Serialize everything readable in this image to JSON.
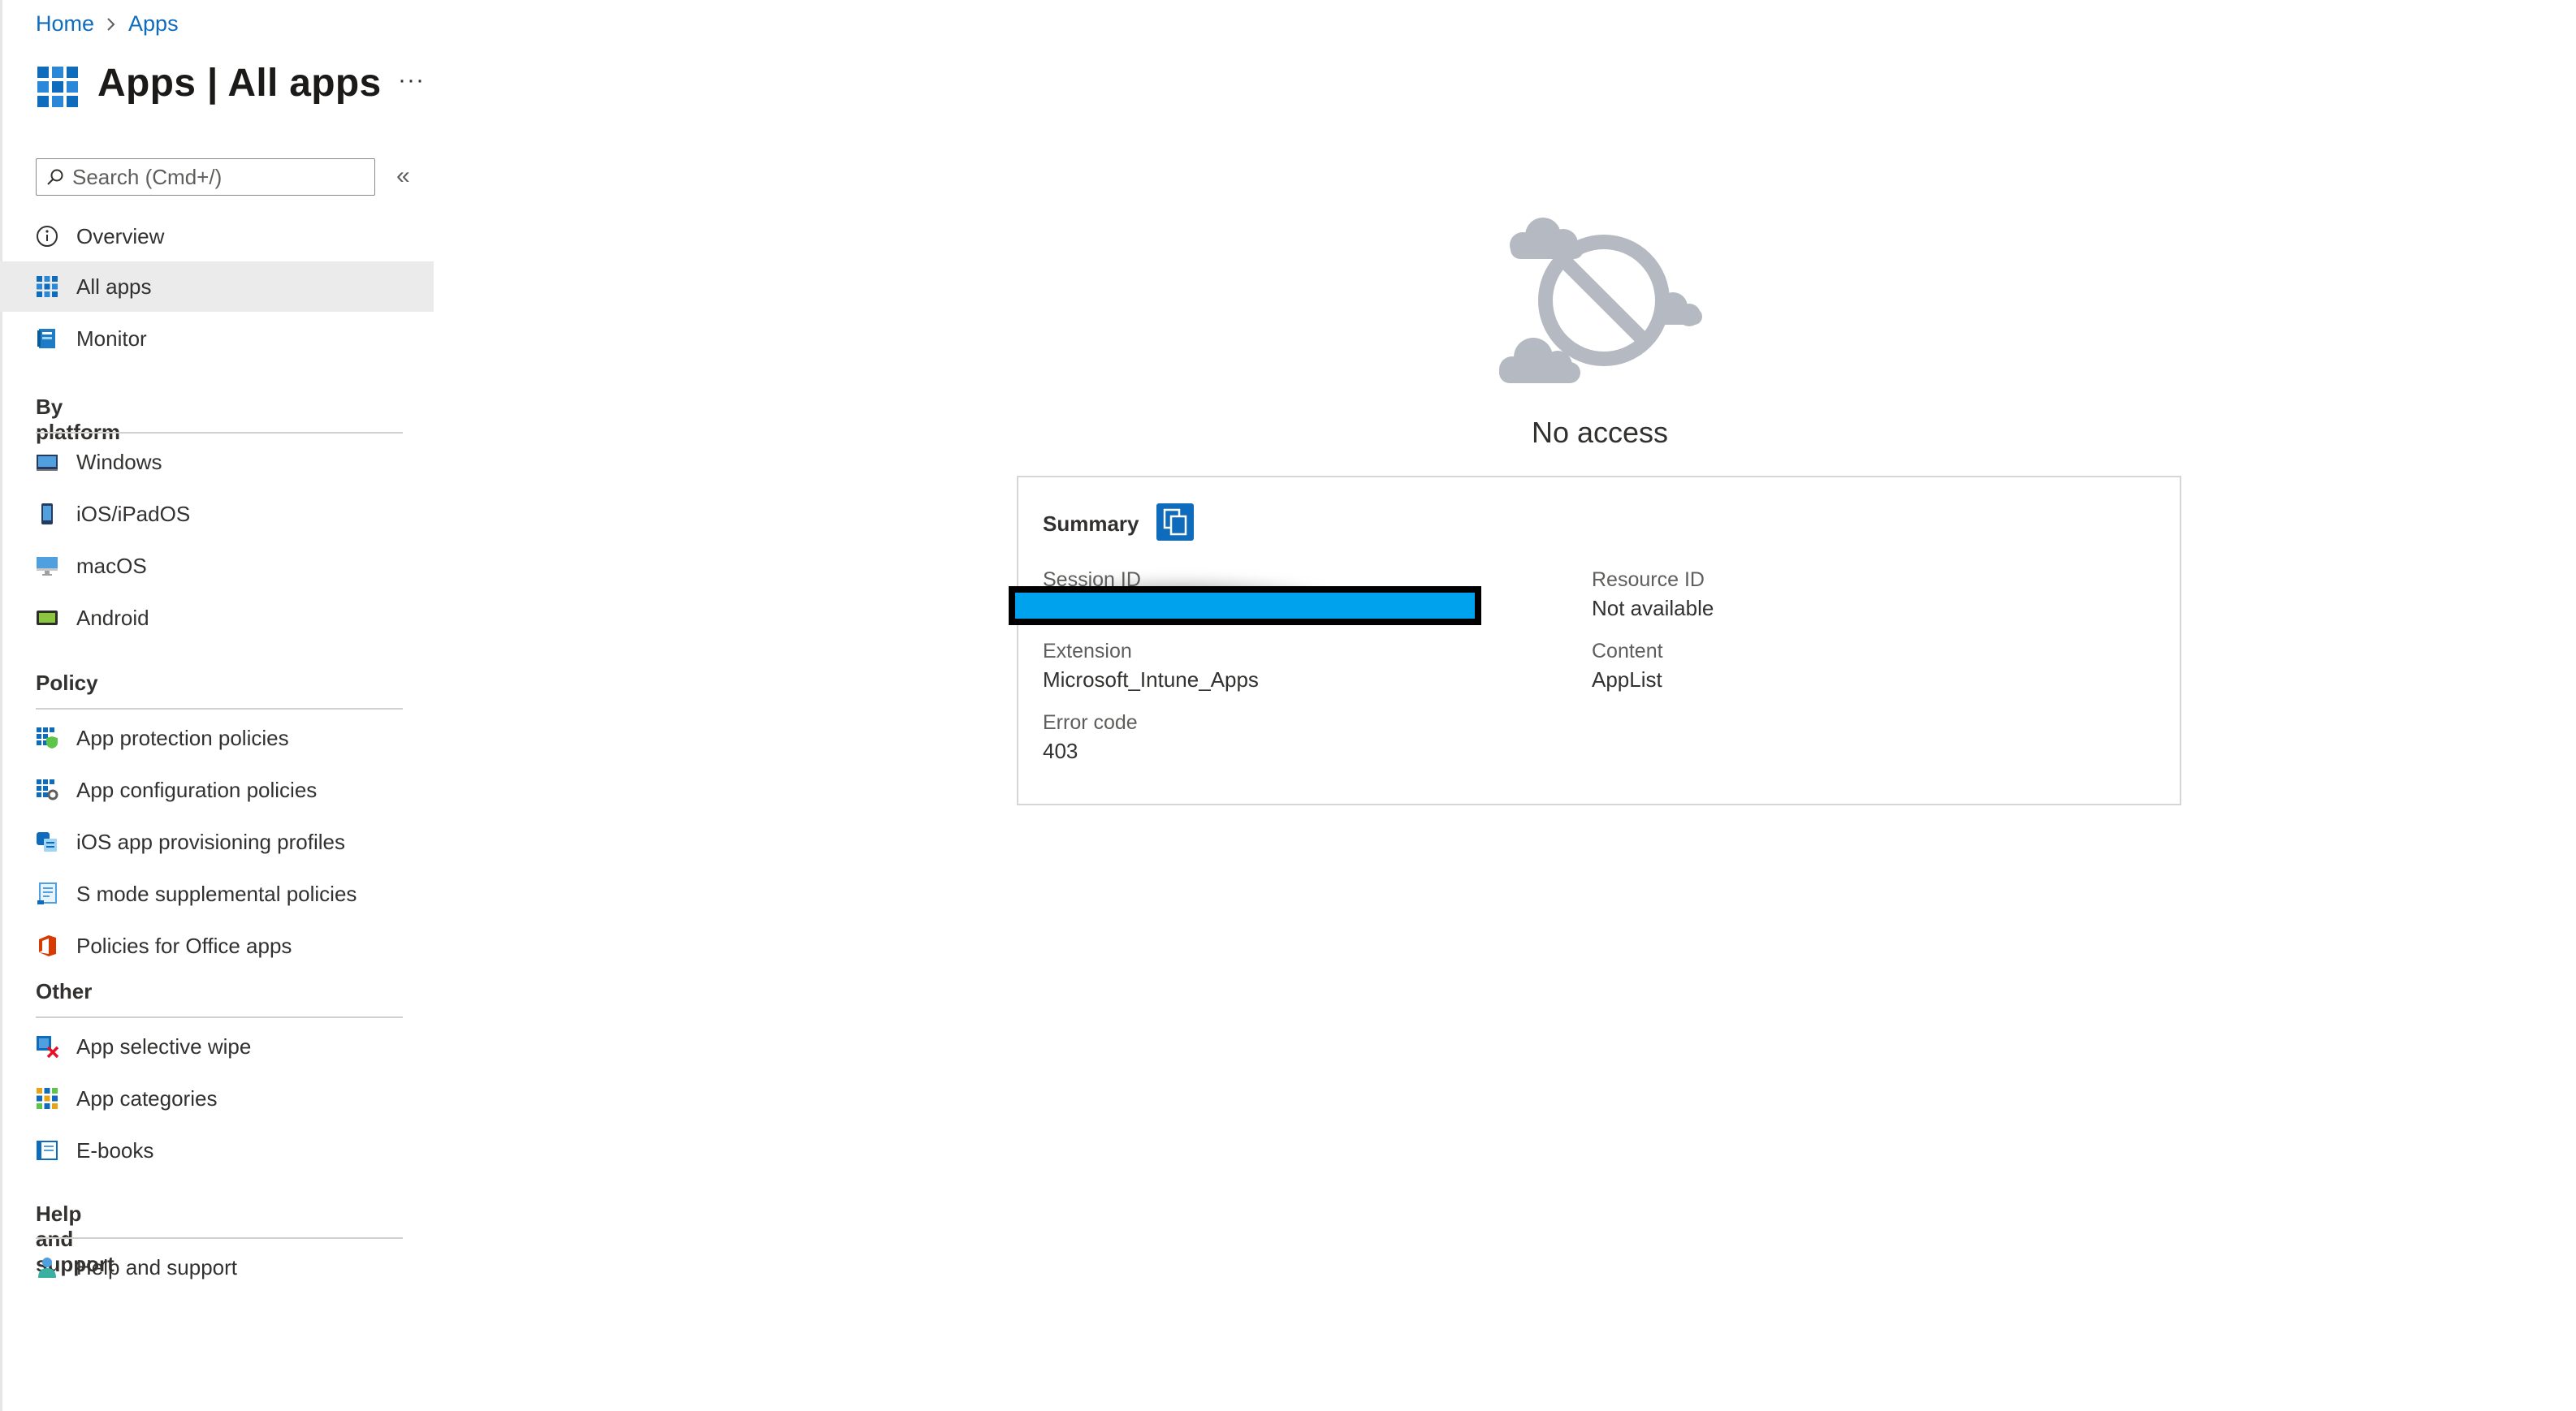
{
  "breadcrumb": {
    "home": "Home",
    "apps": "Apps"
  },
  "header": {
    "title": "Apps | All apps",
    "more": "···"
  },
  "search": {
    "placeholder": "Search (Cmd+/)",
    "collapse": "«"
  },
  "nav": {
    "top_items": [
      {
        "label": "Overview",
        "icon": "info-icon"
      },
      {
        "label": "All apps",
        "icon": "apps-grid-icon",
        "selected": true
      },
      {
        "label": "Monitor",
        "icon": "monitor-book-icon"
      }
    ],
    "sections": [
      {
        "title": "By platform",
        "items": [
          {
            "label": "Windows",
            "icon": "windows-device-icon"
          },
          {
            "label": "iOS/iPadOS",
            "icon": "ios-device-icon"
          },
          {
            "label": "macOS",
            "icon": "macos-display-icon"
          },
          {
            "label": "Android",
            "icon": "android-device-icon"
          }
        ]
      },
      {
        "title": "Policy",
        "items": [
          {
            "label": "App protection policies",
            "icon": "app-protection-icon"
          },
          {
            "label": "App configuration policies",
            "icon": "app-configuration-icon"
          },
          {
            "label": "iOS app provisioning profiles",
            "icon": "provisioning-profile-icon"
          },
          {
            "label": "S mode supplemental policies",
            "icon": "s-mode-policy-icon"
          },
          {
            "label": "Policies for Office apps",
            "icon": "office-icon"
          }
        ]
      },
      {
        "title": "Other",
        "items": [
          {
            "label": "App selective wipe",
            "icon": "selective-wipe-icon"
          },
          {
            "label": "App categories",
            "icon": "app-categories-icon"
          },
          {
            "label": "E-books",
            "icon": "ebook-icon"
          }
        ]
      },
      {
        "title": "Help and support",
        "items": [
          {
            "label": "Help and support",
            "icon": "help-person-icon"
          }
        ]
      }
    ]
  },
  "main": {
    "status_icon": "no-access-cloud-icon",
    "message": "No access",
    "summary": {
      "title": "Summary",
      "copy_icon": "copy-icon",
      "fields": {
        "session_id": {
          "label": "Session ID",
          "value": ""
        },
        "resource_id": {
          "label": "Resource ID",
          "value": "Not available"
        },
        "extension": {
          "label": "Extension",
          "value": "Microsoft_Intune_Apps"
        },
        "content": {
          "label": "Content",
          "value": "AppList"
        },
        "error_code": {
          "label": "Error code",
          "value": "403"
        }
      }
    }
  },
  "colors": {
    "accent": "#0f6cbd",
    "selected_bg": "#ebebeb",
    "redaction": "#00a2ed"
  }
}
